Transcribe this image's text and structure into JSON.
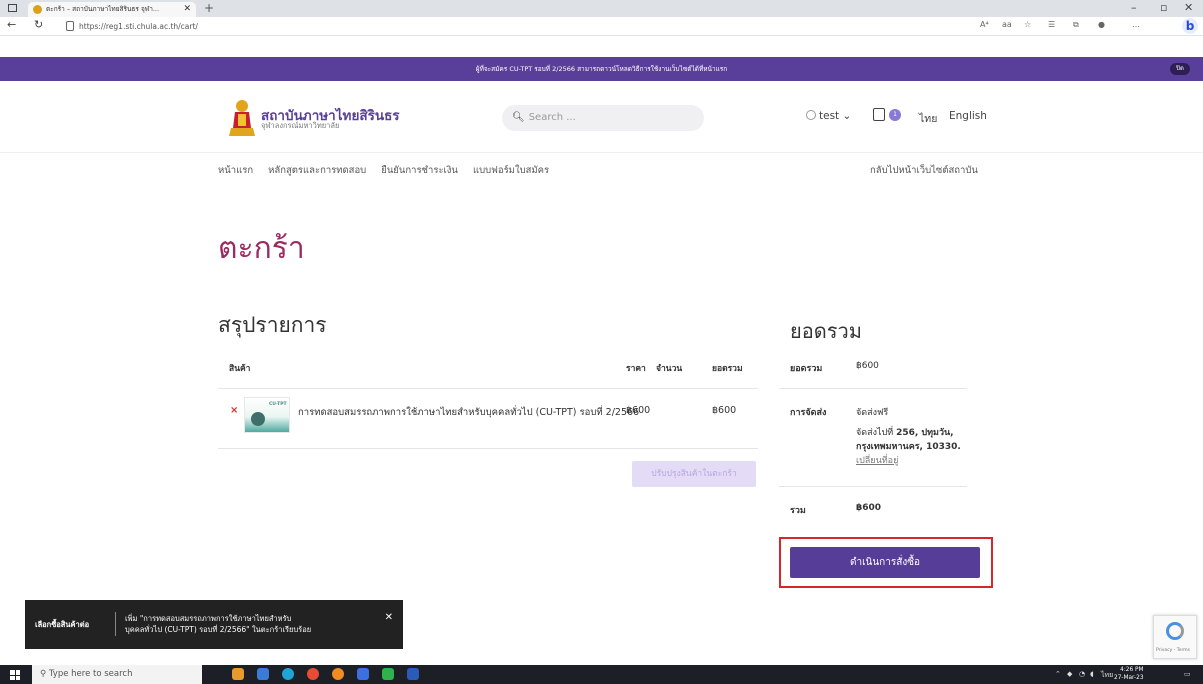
{
  "browser": {
    "tab_title": "ตะกร้า – สถาบันภาษาไทยสิรินธร จุฬา...",
    "url": "https://reg1.sti.chula.ac.th/cart/",
    "read_aloud_icon": "A⁴",
    "aa_icon": "aa"
  },
  "announcement": {
    "text": "ผู้ที่จะสมัคร CU-TPT รอบที่ 2/2566 สามารถดาวน์โหลดวิธีการใช้งานเว็บไซต์ได้ที่หน้าแรก",
    "dismiss_label": "ปิด"
  },
  "header": {
    "brand_title": "สถาบันภาษาไทยสิรินธร",
    "brand_subtitle": "จุฬาลงกรณ์มหาวิทยาลัย",
    "search_placeholder": "Search ...",
    "user_name": "test",
    "cart_count": "1",
    "lang_th": "ไทย",
    "lang_en": "English"
  },
  "nav": {
    "items": [
      "หน้าแรก",
      "หลักสูตรและการทดสอบ",
      "ยืนยันการชำระเงิน",
      "แบบฟอร์มใบสมัคร"
    ],
    "back_link": "กลับไปหน้าเว็บไซต์สถาบัน"
  },
  "page": {
    "title": "ตะกร้า"
  },
  "summary": {
    "title": "สรุปรายการ",
    "columns": {
      "product": "สินค้า",
      "price": "ราคา",
      "quantity": "จำนวน",
      "total": "ยอดรวม"
    },
    "item": {
      "name": "การทดสอบสมรรถภาพการใช้ภาษาไทยสำหรับบุคคลทั่วไป (CU-TPT) รอบที่ 2/2566",
      "price": "฿600",
      "total": "฿600",
      "thumb_tag": "CU-TPT"
    },
    "update_button": "ปรับปรุงสินค้าในตะกร้า"
  },
  "totals": {
    "title": "ยอดรวม",
    "subtotal_label": "ยอดรวม",
    "subtotal_value": "฿600",
    "shipping_label": "การจัดส่ง",
    "shipping_method": "จัดส่งฟรี",
    "shipping_to_prefix": "จัดส่งไปที่",
    "shipping_address_1": "256, ปทุมวัน,",
    "shipping_address_2": "กรุงเทพมหานคร, 10330.",
    "change_address": "เปลี่ยนที่อยู่",
    "total_label": "รวม",
    "total_value": "฿600",
    "checkout_button": "ดำเนินการสั่งซื้อ"
  },
  "toast": {
    "continue_label": "เลือกซื้อสินค้าต่อ",
    "message_1": "เพิ่ม \"การทดสอบสมรรถภาพการใช้ภาษาไทยสำหรับ",
    "message_2": "บุคคลทั่วไป (CU-TPT) รอบที่ 2/2566\" ในตะกร้าเรียบร้อย"
  },
  "recaptcha": {
    "text": "Privacy - Terms"
  },
  "taskbar": {
    "search_placeholder": "Type here to search",
    "lang": "ไทย",
    "time": "4:26 PM",
    "date": "27-Mar-23"
  },
  "colors": {
    "brand_purple": "#5a3f9a",
    "title_magenta": "#9b2a63",
    "checkout_button": "#563d97",
    "highlight_red": "#d9262a"
  }
}
